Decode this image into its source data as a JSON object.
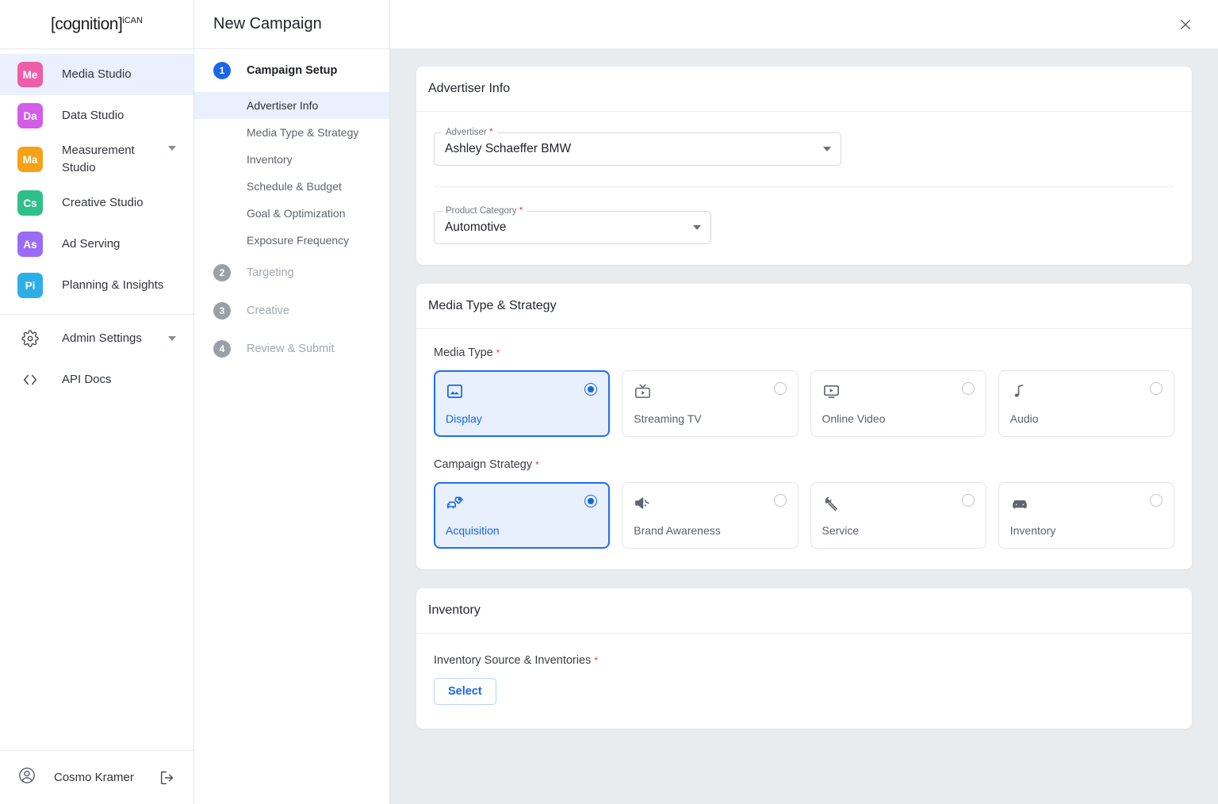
{
  "brand": {
    "logo_text": "[cognition]",
    "logo_superscript": "iCAN",
    "accent_blue": "#1766e0"
  },
  "sidebar": {
    "items": [
      {
        "badge": "Me",
        "label": "Media Studio",
        "color": "#ef5da8",
        "active": true,
        "caret": false
      },
      {
        "badge": "Da",
        "label": "Data Studio",
        "color": "#d35ce8",
        "active": false,
        "caret": false
      },
      {
        "badge": "Ma",
        "label": "Measurement Studio",
        "color": "#f5a218",
        "active": false,
        "caret": true
      },
      {
        "badge": "Cs",
        "label": "Creative Studio",
        "color": "#2ec08b",
        "active": false,
        "caret": false
      },
      {
        "badge": "As",
        "label": "Ad Serving",
        "color": "#9a6cf5",
        "active": false,
        "caret": false
      },
      {
        "badge": "Pi",
        "label": "Planning & Insights",
        "color": "#2eaee8",
        "active": false,
        "caret": false
      }
    ],
    "secondary": [
      {
        "icon": "gear-icon",
        "label": "Admin Settings",
        "caret": true
      },
      {
        "icon": "code-icon",
        "label": "API Docs",
        "caret": false
      }
    ],
    "user": {
      "name": "Cosmo Kramer"
    }
  },
  "stepnav": {
    "steps": [
      {
        "number": "1",
        "label": "Campaign Setup",
        "active": true,
        "substeps": [
          {
            "label": "Advertiser Info",
            "current": true
          },
          {
            "label": "Media Type & Strategy",
            "current": false
          },
          {
            "label": "Inventory",
            "current": false
          },
          {
            "label": "Schedule & Budget",
            "current": false
          },
          {
            "label": "Goal & Optimization",
            "current": false
          },
          {
            "label": "Exposure Frequency",
            "current": false
          }
        ]
      },
      {
        "number": "2",
        "label": "Targeting",
        "active": false,
        "substeps": []
      },
      {
        "number": "3",
        "label": "Creative",
        "active": false,
        "substeps": []
      },
      {
        "number": "4",
        "label": "Review & Submit",
        "active": false,
        "substeps": []
      }
    ]
  },
  "header": {
    "title": "New Campaign",
    "close_label": "✕"
  },
  "advertiser_info": {
    "card_title": "Advertiser Info",
    "advertiser": {
      "legend": "Advertiser",
      "value": "Ashley Schaeffer BMW",
      "required": true
    },
    "product_category": {
      "legend": "Product Category",
      "value": "Automotive",
      "required": true
    }
  },
  "media_strategy": {
    "card_title": "Media Type & Strategy",
    "media_type_label": "Media Type",
    "media_type_required": true,
    "media_types": [
      {
        "label": "Display",
        "icon": "image-icon",
        "selected": true
      },
      {
        "label": "Streaming TV",
        "icon": "tv-icon",
        "selected": false
      },
      {
        "label": "Online Video",
        "icon": "video-play-icon",
        "selected": false
      },
      {
        "label": "Audio",
        "icon": "music-note-icon",
        "selected": false
      }
    ],
    "strategy_label": "Campaign Strategy",
    "strategy_required": true,
    "strategies": [
      {
        "label": "Acquisition",
        "icon": "car-tag-icon",
        "selected": true
      },
      {
        "label": "Brand Awareness",
        "icon": "megaphone-icon",
        "selected": false
      },
      {
        "label": "Service",
        "icon": "wrench-icon",
        "selected": false
      },
      {
        "label": "Inventory",
        "icon": "car-icon",
        "selected": false
      }
    ]
  },
  "inventory": {
    "card_title": "Inventory",
    "source_label": "Inventory Source & Inventories",
    "source_required": true,
    "select_button": "Select"
  }
}
